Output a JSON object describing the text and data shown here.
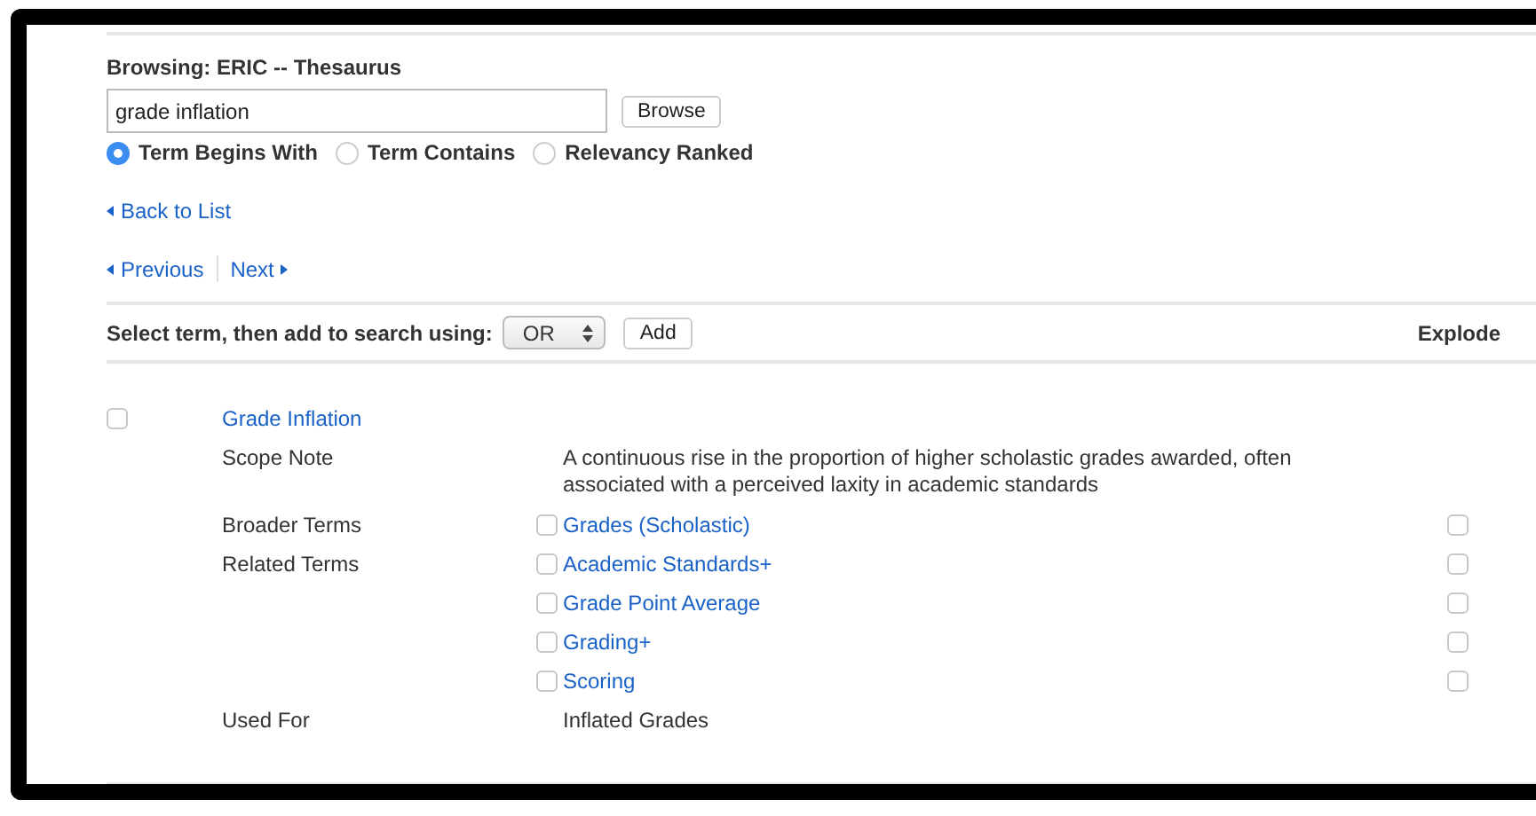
{
  "title": "Browsing: ERIC -- Thesaurus",
  "search": {
    "value": "grade inflation"
  },
  "browse_button": "Browse",
  "match_options": [
    {
      "label": "Term Begins With",
      "selected": true
    },
    {
      "label": "Term Contains",
      "selected": false
    },
    {
      "label": "Relevancy Ranked",
      "selected": false
    }
  ],
  "back_link": "Back to List",
  "pager": {
    "previous": "Previous",
    "next": "Next"
  },
  "add_bar": {
    "label": "Select term, then add to search using:",
    "operator": "OR",
    "add_button": "Add",
    "explode_header": "Explode"
  },
  "term": {
    "label": "Grade Inflation",
    "checked": false,
    "sections": [
      {
        "kind": "note",
        "label": "Scope Note",
        "text": "A continuous rise in the proportion of higher scholastic grades awarded, often associated with a perceived laxity in academic standards"
      },
      {
        "kind": "terms",
        "label": "Broader Terms",
        "terms": [
          {
            "label": "Grades (Scholastic)",
            "checked": false,
            "explode": false
          }
        ]
      },
      {
        "kind": "terms",
        "label": "Related Terms",
        "terms": [
          {
            "label": "Academic Standards+",
            "checked": false,
            "explode": false
          },
          {
            "label": "Grade Point Average",
            "checked": false,
            "explode": false
          },
          {
            "label": "Grading+",
            "checked": false,
            "explode": false
          },
          {
            "label": "Scoring",
            "checked": false,
            "explode": false
          }
        ]
      },
      {
        "kind": "note",
        "label": "Used For",
        "text": "Inflated Grades"
      }
    ]
  }
}
